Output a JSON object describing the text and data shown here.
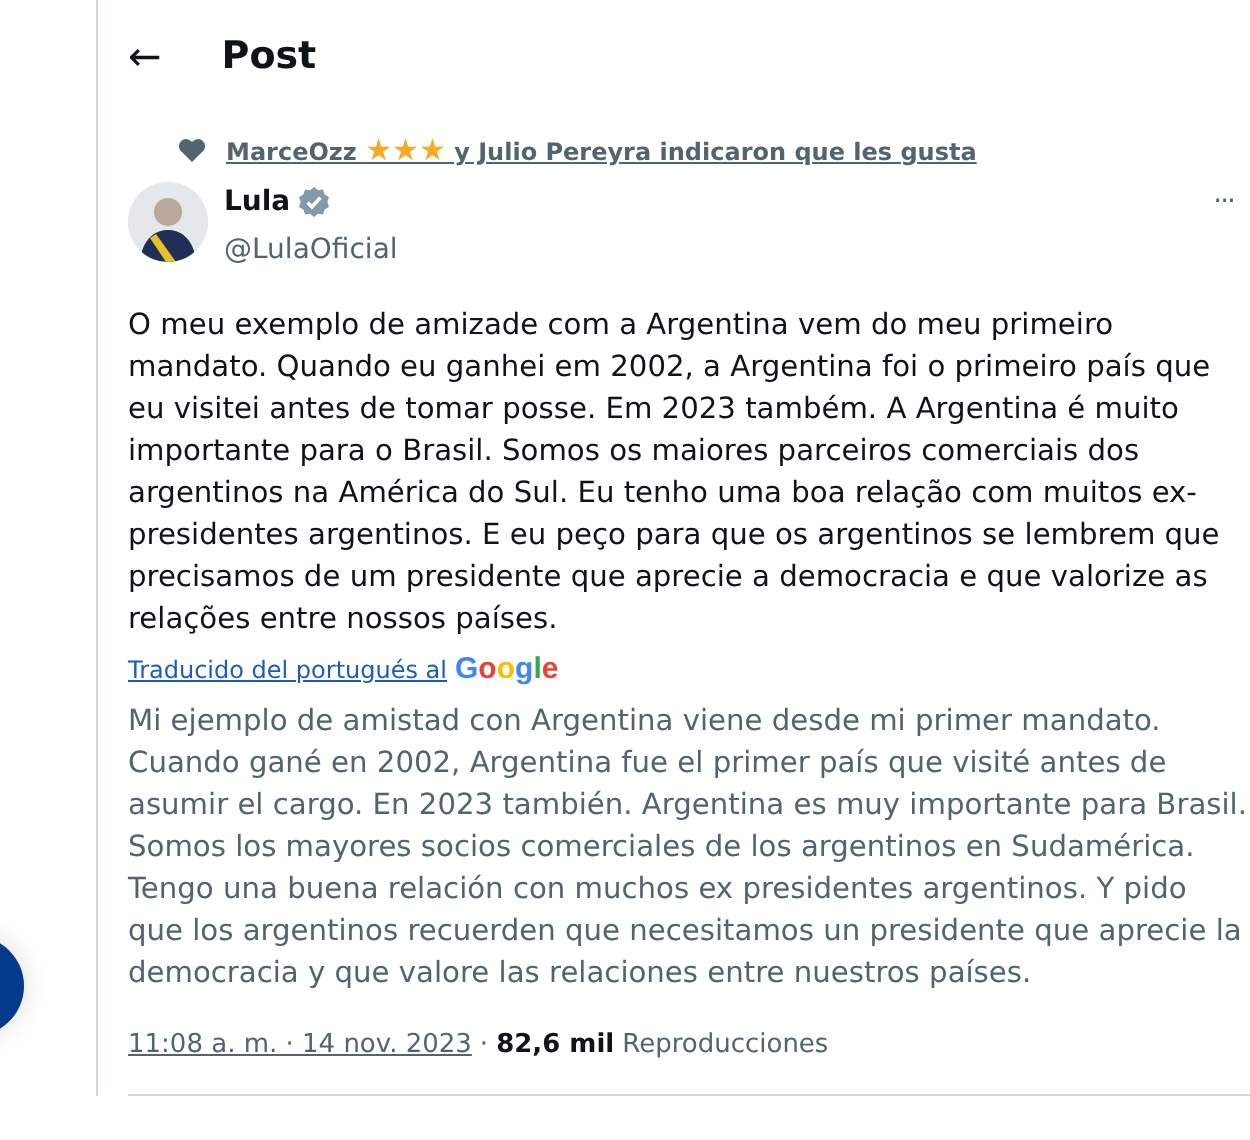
{
  "header": {
    "back": "←",
    "title": "Post"
  },
  "social_context": {
    "name": "MarceOzz",
    "emoji": "★★★",
    "rest": " y Julio Pereyra indicaron que les gusta"
  },
  "author": {
    "name": "Lula",
    "verified": true,
    "handle": "@LulaOficial",
    "more": "···"
  },
  "text": "O meu exemplo de amizade com a Argentina vem do meu primeiro mandato. Quando eu ganhei em 2002, a Argentina foi o primeiro país que eu visitei antes de tomar posse. Em 2023 também. A Argentina é muito importante para o Brasil. Somos os maiores parceiros comerciais dos argentinos na América do Sul. Eu tenho uma boa relação com muitos ex-presidentes argentinos. E eu peço para que os argentinos se lembrem que precisamos de um presidente que aprecie a democracia e que valorize as relações entre nossos países.",
  "translation_note": "Traducido del portugués al",
  "translator": "Google",
  "translation": "Mi ejemplo de amistad con Argentina viene desde mi primer mandato. Cuando gané en 2002, Argentina fue el primer país que visité antes de asumir el cargo. En 2023 también. Argentina es muy importante para Brasil. Somos los mayores socios comerciales de los argentinos en Sudamérica. Tengo una buena relación con muchos ex presidentes argentinos. Y pido que los argentinos recuerden que necesitamos un presidente que aprecie la democracia y que valore las relaciones entre nuestros países.",
  "meta": {
    "time": "11:08 a. m. · 14 nov. 2023",
    "sep": "·",
    "views": "82,6 mil",
    "views_label": "Reproducciones"
  }
}
